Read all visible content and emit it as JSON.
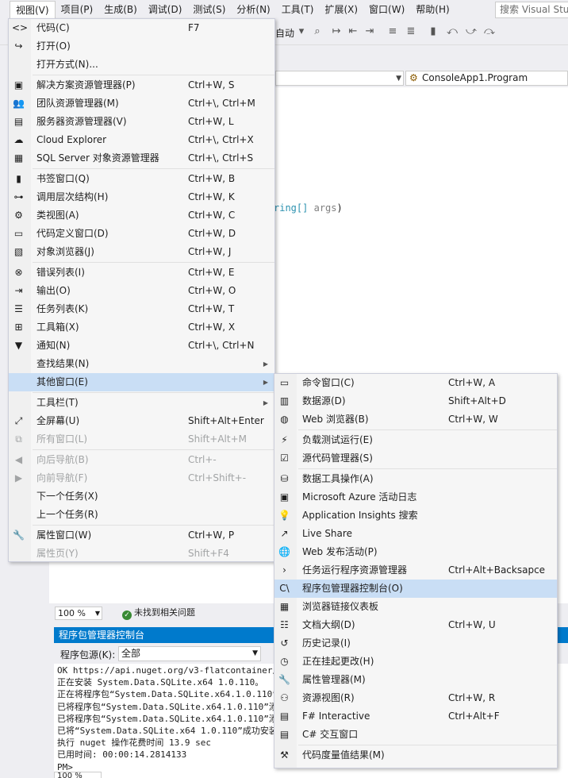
{
  "menubar": {
    "items": [
      "视图(V)",
      "项目(P)",
      "生成(B)",
      "调试(D)",
      "测试(S)",
      "分析(N)",
      "工具(T)",
      "扩展(X)",
      "窗口(W)",
      "帮助(H)"
    ],
    "search_placeholder": "搜索 Visual Stu"
  },
  "toolbar": {
    "config_text": "自动"
  },
  "navbar": {
    "class_dropdown": "ConsoleApp1.Program"
  },
  "code": {
    "type": "ring[]",
    "param": "args",
    "close": ")"
  },
  "editor_status": {
    "zoom": "100 %",
    "issues": "未找到相关问题"
  },
  "pmc": {
    "title": "程序包管理器控制台",
    "source_label": "程序包源(K):",
    "source_value": "全部",
    "lines": [
      "  OK https://api.nuget.org/v3-flatcontainer/sy",
      "正在安装 System.Data.SQLite.x64 1.0.110。",
      "正在将程序包“System.Data.SQLite.x64.1.0.110”",
      "已将程序包“System.Data.SQLite.x64.1.0.110”添",
      "已将程序包“System.Data.SQLite.x64.1.0.110”添",
      "已将“System.Data.SQLite.x64 1.0.110”成功安装",
      "执行 nuget 操作花费时间 13.9 sec",
      "已用时间: 00:00:14.2814133",
      "PM>"
    ],
    "bottom_zoom": "100 %"
  },
  "view_menu": {
    "groups": [
      [
        {
          "icon": "<>",
          "label": "代码(C)",
          "shortcut": "F7"
        },
        {
          "icon": "↪",
          "label": "打开(O)",
          "shortcut": ""
        },
        {
          "icon": "",
          "label": "打开方式(N)...",
          "shortcut": ""
        }
      ],
      [
        {
          "icon": "▣",
          "label": "解决方案资源管理器(P)",
          "shortcut": "Ctrl+W, S"
        },
        {
          "icon": "👥",
          "label": "团队资源管理器(M)",
          "shortcut": "Ctrl+\\, Ctrl+M"
        },
        {
          "icon": "▤",
          "label": "服务器资源管理器(V)",
          "shortcut": "Ctrl+W, L"
        },
        {
          "icon": "☁",
          "label": "Cloud Explorer",
          "shortcut": "Ctrl+\\, Ctrl+X"
        },
        {
          "icon": "▦",
          "label": "SQL Server 对象资源管理器",
          "shortcut": "Ctrl+\\, Ctrl+S"
        }
      ],
      [
        {
          "icon": "▮",
          "label": "书签窗口(Q)",
          "shortcut": "Ctrl+W, B"
        },
        {
          "icon": "⊶",
          "label": "调用层次结构(H)",
          "shortcut": "Ctrl+W, K"
        },
        {
          "icon": "⚙",
          "label": "类视图(A)",
          "shortcut": "Ctrl+W, C"
        },
        {
          "icon": "▭",
          "label": "代码定义窗口(D)",
          "shortcut": "Ctrl+W, D"
        },
        {
          "icon": "▧",
          "label": "对象浏览器(J)",
          "shortcut": "Ctrl+W, J"
        }
      ],
      [
        {
          "icon": "⊗",
          "label": "错误列表(I)",
          "shortcut": "Ctrl+W, E"
        },
        {
          "icon": "⇥",
          "label": "输出(O)",
          "shortcut": "Ctrl+W, O"
        },
        {
          "icon": "☰",
          "label": "任务列表(K)",
          "shortcut": "Ctrl+W, T"
        },
        {
          "icon": "⊞",
          "label": "工具箱(X)",
          "shortcut": "Ctrl+W, X"
        },
        {
          "icon": "▼",
          "label": "通知(N)",
          "shortcut": "Ctrl+\\, Ctrl+N"
        },
        {
          "icon": "",
          "label": "查找结果(N)",
          "shortcut": "",
          "submenu": true
        },
        {
          "icon": "",
          "label": "其他窗口(E)",
          "shortcut": "",
          "submenu": true,
          "highlight": true
        }
      ],
      [
        {
          "icon": "",
          "label": "工具栏(T)",
          "shortcut": "",
          "submenu": true
        },
        {
          "icon": "⤢",
          "label": "全屏幕(U)",
          "shortcut": "Shift+Alt+Enter"
        },
        {
          "icon": "⧉",
          "label": "所有窗口(L)",
          "shortcut": "Shift+Alt+M",
          "disabled": true
        }
      ],
      [
        {
          "icon": "◀",
          "label": "向后导航(B)",
          "shortcut": "Ctrl+-",
          "disabled": true
        },
        {
          "icon": "▶",
          "label": "向前导航(F)",
          "shortcut": "Ctrl+Shift+-",
          "disabled": true
        },
        {
          "icon": "",
          "label": "下一个任务(X)",
          "shortcut": ""
        },
        {
          "icon": "",
          "label": "上一个任务(R)",
          "shortcut": ""
        }
      ],
      [
        {
          "icon": "🔧",
          "label": "属性窗口(W)",
          "shortcut": "Ctrl+W, P"
        },
        {
          "icon": "",
          "label": "属性页(Y)",
          "shortcut": "Shift+F4",
          "disabled": true
        }
      ]
    ]
  },
  "other_menu": {
    "groups": [
      [
        {
          "icon": "▭",
          "label": "命令窗口(C)",
          "shortcut": "Ctrl+W, A"
        },
        {
          "icon": "▥",
          "label": "数据源(D)",
          "shortcut": "Shift+Alt+D"
        },
        {
          "icon": "◍",
          "label": "Web 浏览器(B)",
          "shortcut": "Ctrl+W, W"
        }
      ],
      [
        {
          "icon": "⚡",
          "label": "负载测试运行(E)",
          "shortcut": ""
        },
        {
          "icon": "☑",
          "label": "源代码管理器(S)",
          "shortcut": ""
        }
      ],
      [
        {
          "icon": "⛁",
          "label": "数据工具操作(A)",
          "shortcut": ""
        },
        {
          "icon": "▣",
          "label": "Microsoft Azure 活动日志",
          "shortcut": ""
        },
        {
          "icon": "💡",
          "label": "Application Insights 搜索",
          "shortcut": ""
        },
        {
          "icon": "↗",
          "label": "Live Share",
          "shortcut": ""
        },
        {
          "icon": "🌐",
          "label": "Web 发布活动(P)",
          "shortcut": ""
        },
        {
          "icon": "›",
          "label": "任务运行程序资源管理器",
          "shortcut": "Ctrl+Alt+Backsapce"
        },
        {
          "icon": "C\\",
          "label": "程序包管理器控制台(O)",
          "shortcut": "",
          "highlight": true
        },
        {
          "icon": "▦",
          "label": "浏览器链接仪表板",
          "shortcut": ""
        },
        {
          "icon": "☷",
          "label": "文档大纲(D)",
          "shortcut": "Ctrl+W, U"
        },
        {
          "icon": "↺",
          "label": "历史记录(I)",
          "shortcut": ""
        },
        {
          "icon": "◷",
          "label": "正在挂起更改(H)",
          "shortcut": ""
        },
        {
          "icon": "🔧",
          "label": "属性管理器(M)",
          "shortcut": ""
        },
        {
          "icon": "⚇",
          "label": "资源视图(R)",
          "shortcut": "Ctrl+W, R"
        },
        {
          "icon": "▤",
          "label": "F# Interactive",
          "shortcut": "Ctrl+Alt+F"
        },
        {
          "icon": "▤",
          "label": "C# 交互窗口",
          "shortcut": ""
        }
      ],
      [
        {
          "icon": "⚒",
          "label": "代码度量值结果(M)",
          "shortcut": ""
        }
      ]
    ]
  },
  "colors": {
    "accent": "#007acc",
    "highlight": "#c9def5",
    "disabled": "#a2a4a5"
  }
}
